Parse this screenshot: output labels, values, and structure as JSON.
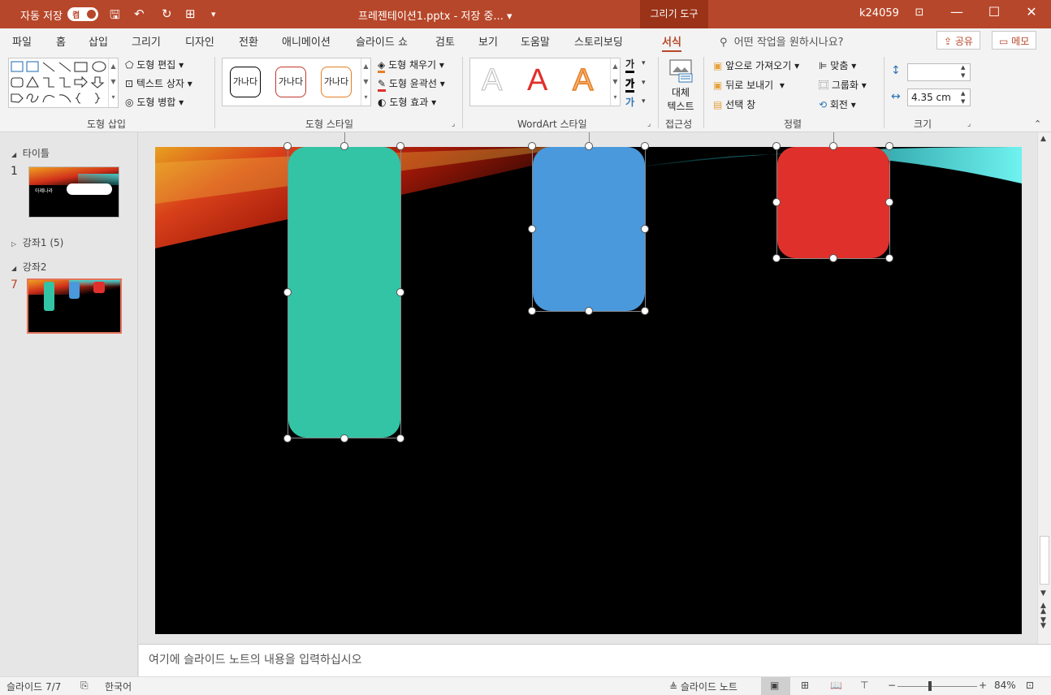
{
  "titlebar": {
    "autosave_label": "자동 저장",
    "autosave_toggle": "켬",
    "doc_title": "프레젠테이션1.pptx - 저장 중... ▾",
    "context_tab": "그리기 도구",
    "user": "k24059"
  },
  "menu": {
    "items": [
      "파일",
      "홈",
      "삽입",
      "그리기",
      "디자인",
      "전환",
      "애니메이션",
      "슬라이드 쇼",
      "검토",
      "보기",
      "도움말",
      "스토리보딩",
      "서식"
    ],
    "search_placeholder": "어떤 작업을 원하시나요?",
    "share_label": "공유",
    "comment_label": "메모"
  },
  "ribbon": {
    "insert_shapes": {
      "label": "도형 삽입",
      "edit_shape": "도형 편집",
      "text_box": "텍스트 상자",
      "merge_shapes": "도형 병합"
    },
    "shape_styles": {
      "label": "도형 스타일",
      "preset_text": "가나다",
      "fill": "도형 채우기",
      "outline": "도형 윤곽선",
      "effects": "도형 효과"
    },
    "wordart": {
      "label": "WordArt 스타일",
      "letter": "A",
      "text_fill_glyph": "가"
    },
    "accessibility": {
      "label": "접근성",
      "alt_text_1": "대체",
      "alt_text_2": "텍스트"
    },
    "arrange": {
      "label": "정렬",
      "bring_forward": "앞으로 가져오기",
      "send_backward": "뒤로 보내기",
      "selection_pane": "선택 창",
      "align": "맞춤",
      "group": "그룹화",
      "rotate": "회전"
    },
    "size": {
      "label": "크기",
      "height_value": "",
      "width_value": "4.35 cm"
    }
  },
  "slides_panel": {
    "section1": "타이틀",
    "slide1_num": "1",
    "slide1_thumb_text": "아제나라",
    "section2": "강좌1 (5)",
    "section3": "강좌2",
    "slide7_num": "7"
  },
  "slide": {
    "shapes": [
      {
        "name": "green-shape",
        "color": "#33c4a5"
      },
      {
        "name": "blue-shape",
        "color": "#4a99dc"
      },
      {
        "name": "red-shape",
        "color": "#e0302b"
      }
    ]
  },
  "notes": {
    "placeholder": "여기에 슬라이드 노트의 내용을 입력하십시오"
  },
  "status": {
    "slide_info": "슬라이드 7/7",
    "language": "한국어",
    "notes_btn": "슬라이드 노트",
    "zoom": "84%"
  },
  "colors": {
    "accent": "#b7472a",
    "titlebar_bg": "#b7472a"
  }
}
